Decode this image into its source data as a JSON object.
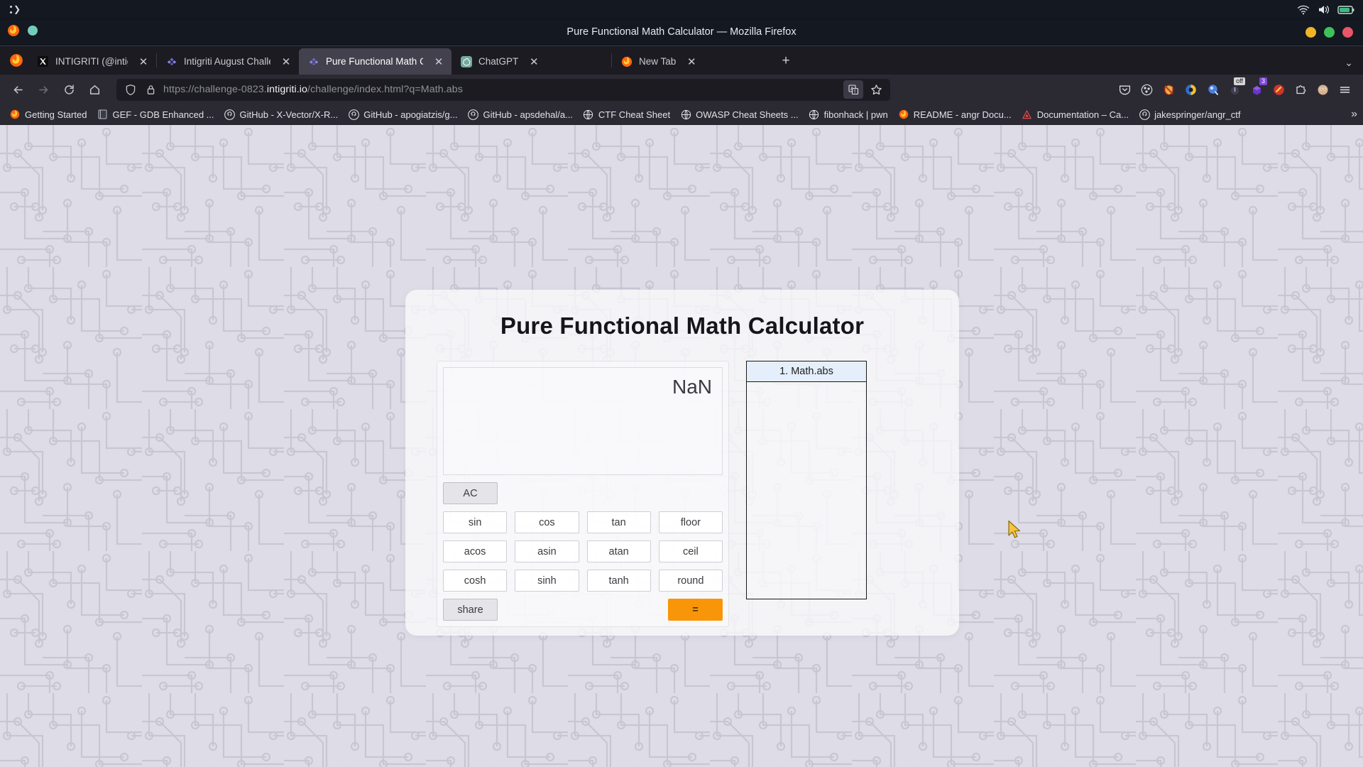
{
  "os_bar": {
    "logo_icon": "terminal-prompt-icon",
    "status_icons": [
      "wifi-icon",
      "volume-icon",
      "battery-icon"
    ],
    "window_dots": [
      "minimize-dot",
      "maximize-dot",
      "close-dot"
    ]
  },
  "browser": {
    "window_title": "Pure Functional Math Calculator — Mozilla Firefox",
    "app_icon": "firefox-icon",
    "tabs": [
      {
        "label": "INTIGRITI (@intigriti) / X",
        "favicon": "x-logo-icon",
        "active": false
      },
      {
        "label": "Intigriti August Challenge",
        "favicon": "intigriti-icon",
        "active": false
      },
      {
        "label": "Pure Functional Math Calc",
        "favicon": "intigriti-icon",
        "active": true
      },
      {
        "label": "ChatGPT",
        "favicon": "chatgpt-icon",
        "active": false
      },
      {
        "label": "New Tab",
        "favicon": "firefox-icon",
        "active": false
      }
    ],
    "new_tab_label": "+",
    "tab_close_label": "✕",
    "toolbar": {
      "back_icon": "back-arrow-icon",
      "forward_icon": "forward-arrow-icon",
      "reload_icon": "reload-icon",
      "home_icon": "home-icon",
      "shield_icon": "shield-icon",
      "lock_icon": "padlock-icon",
      "url_prefix": "https://challenge-0823.",
      "url_domain": "intigriti.io",
      "url_suffix": "/challenge/index.html?q=Math.abs",
      "url_full": "https://challenge-0823.intigriti.io/challenge/index.html?q=Math.abs",
      "translate_icon": "translate-icon",
      "bookmark_star_icon": "star-icon",
      "extensions": [
        {
          "name": "pocket-icon",
          "badge": ""
        },
        {
          "name": "cookie-icon",
          "badge": ""
        },
        {
          "name": "ublock-origin-icon",
          "badge": ""
        },
        {
          "name": "color-picker-icon",
          "badge": ""
        },
        {
          "name": "wappalyzer-icon",
          "badge": ""
        },
        {
          "name": "toggle-off-icon",
          "badge": "off"
        },
        {
          "name": "hackbar-icon",
          "badge": "3"
        },
        {
          "name": "adblock-icon",
          "badge": ""
        },
        {
          "name": "extensions-puzzle-icon",
          "badge": ""
        },
        {
          "name": "account-avatar-icon",
          "badge": ""
        },
        {
          "name": "hamburger-menu-icon",
          "badge": ""
        }
      ]
    },
    "bookmarks": [
      {
        "label": "Getting Started",
        "icon": "firefox-icon"
      },
      {
        "label": "GEF - GDB Enhanced ...",
        "icon": "book-icon"
      },
      {
        "label": "GitHub - X-Vector/X-R...",
        "icon": "github-icon"
      },
      {
        "label": "GitHub - apogiatzis/g...",
        "icon": "github-icon"
      },
      {
        "label": "GitHub - apsdehal/a...",
        "icon": "github-icon"
      },
      {
        "label": "CTF Cheat Sheet",
        "icon": "globe-icon"
      },
      {
        "label": "OWASP Cheat Sheets ...",
        "icon": "globe-icon"
      },
      {
        "label": "fibonhack | pwn",
        "icon": "globe-icon"
      },
      {
        "label": "README - angr Docu...",
        "icon": "firefox-icon"
      },
      {
        "label": "Documentation – Ca...",
        "icon": "caido-icon"
      },
      {
        "label": "jakespringer/angr_ctf",
        "icon": "github-icon"
      }
    ],
    "bookmarks_overflow_label": "»",
    "tabstrip_collapse_label": "⌄"
  },
  "calculator": {
    "title": "Pure Functional Math Calculator",
    "display_value": "NaN",
    "clear_button": "AC",
    "share_button": "share",
    "equals_button": "=",
    "function_rows": [
      [
        "sin",
        "cos",
        "tan",
        "floor"
      ],
      [
        "acos",
        "asin",
        "atan",
        "ceil"
      ],
      [
        "cosh",
        "sinh",
        "tanh",
        "round"
      ]
    ],
    "history": [
      {
        "label": "1. Math.abs",
        "selected": true
      }
    ],
    "accent_color": "#f99508",
    "history_highlight_color": "#e4effb"
  },
  "page_background": {
    "base_color": "#dedce6",
    "pattern_color": "#c9c6d4",
    "pattern_name": "circuit-board-pattern"
  },
  "cursor": {
    "name": "mouse-pointer",
    "color": "#f5c43a"
  }
}
